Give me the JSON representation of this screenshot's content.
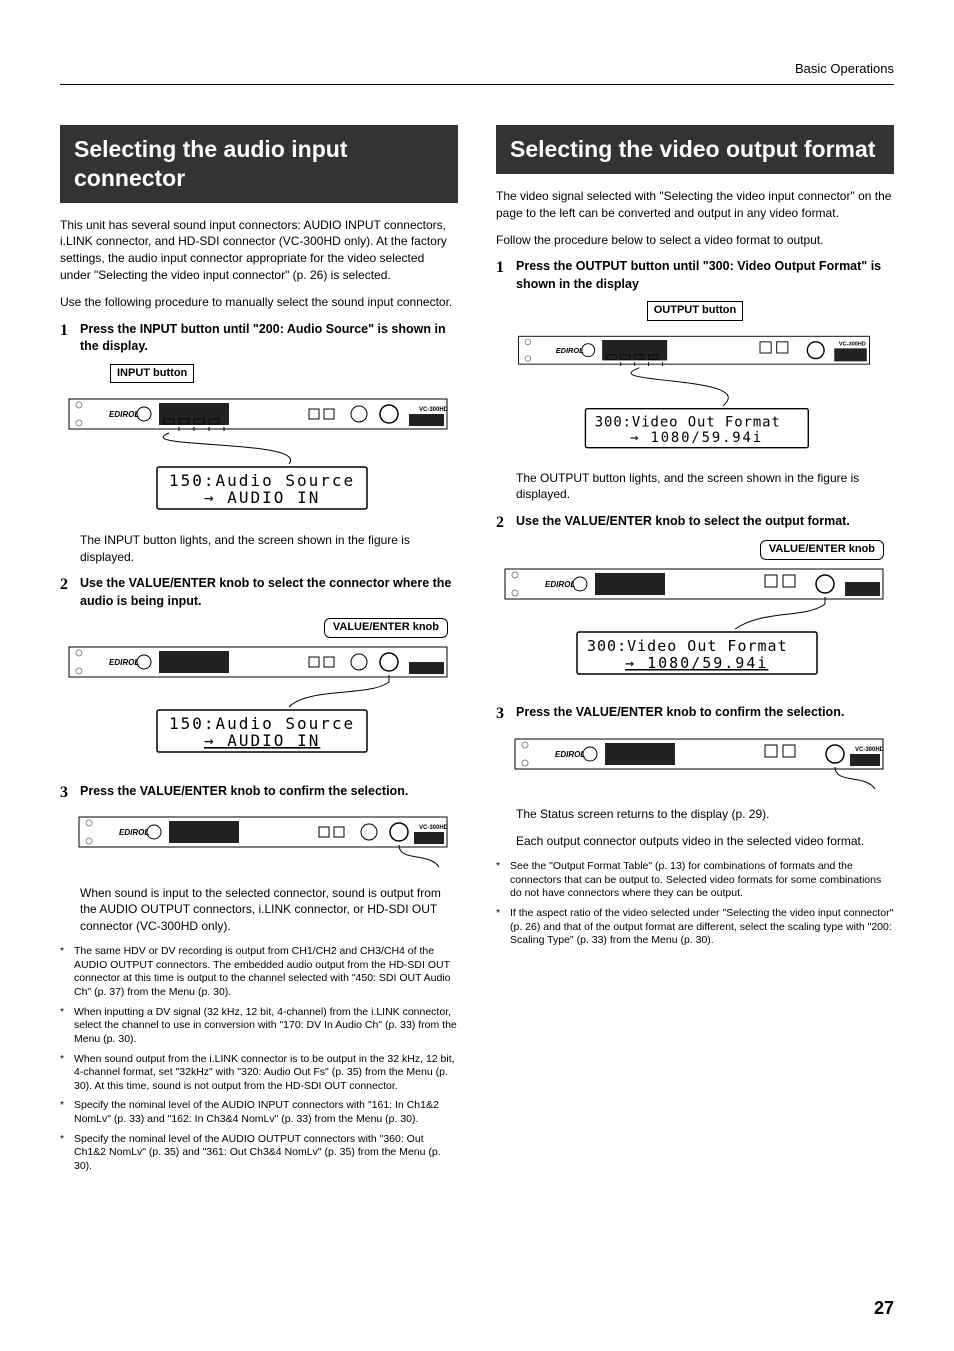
{
  "header": {
    "right": "Basic Operations"
  },
  "page_number": "27",
  "left": {
    "heading": "Selecting the audio input connector",
    "intro1": "This unit has several sound input connectors: AUDIO INPUT connectors, i.LINK connector, and HD-SDI connector (VC-300HD only). At the factory settings, the audio input connector appropriate for the video selected under  \"Selecting the video input connector\" (p. 26) is selected.",
    "intro2": "Use the following procedure to manually select the sound input connector.",
    "step1": "Press the INPUT button until \"200: Audio Source\" is shown in the display.",
    "label_input": "INPUT button",
    "lcd1_line1": "150:Audio Source",
    "lcd1_line2": "AUDIO IN",
    "after1": "The INPUT button lights, and the screen shown in the figure is displayed.",
    "step2": "Use the VALUE/ENTER knob to select the connector where the audio is being input.",
    "label_value": "VALUE/ENTER knob",
    "lcd2_line1": "150:Audio Source",
    "lcd2_line2": "AUDIO IN",
    "step3": "Press the VALUE/ENTER knob to confirm the selection.",
    "after3": "When sound is input to the selected connector, sound is output from the AUDIO OUTPUT connectors, i.LINK connector, or HD-SDI OUT connector (VC-300HD only).",
    "notes": [
      "The same HDV or DV recording is output from CH1/CH2 and CH3/CH4 of the AUDIO OUTPUT connectors. The embedded audio output from the HD-SDI OUT connector at this time is output to the channel selected with \"450: SDI OUT Audio Ch\" (p. 37) from the Menu (p. 30).",
      "When inputting a DV signal (32 kHz, 12 bit, 4-channel) from the i.LINK connector, select the channel to use in conversion with \"170: DV In Audio Ch\" (p. 33) from the Menu (p. 30).",
      "When sound output from the i.LINK connector is to be output in the 32 kHz, 12 bit, 4-channel format, set \"32kHz\" with \"320: Audio Out Fs\" (p. 35) from the Menu (p. 30). At this time, sound is not output from the HD-SDI OUT connector.",
      "Specify the nominal level of the AUDIO INPUT connectors with \"161: In Ch1&2 NomLv\" (p. 33) and \"162: In Ch3&4 NomLv\" (p. 33) from the Menu (p. 30).",
      "Specify the nominal level of the AUDIO OUTPUT connectors with \"360: Out Ch1&2 NomLv\" (p. 35) and \"361: Out Ch3&4 NomLv\" (p. 35) from the Menu (p. 30)."
    ]
  },
  "right": {
    "heading": "Selecting the video output format",
    "intro1": "The video signal selected with \"Selecting the video input connector\" on the page to the left can be converted and output in any video format.",
    "intro2": "Follow the procedure below to select a video format to output.",
    "step1": "Press the OUTPUT button until \"300: Video Output Format\" is shown in the display",
    "label_output": "OUTPUT button",
    "lcd1_line1": "300:Video Out Format",
    "lcd1_line2": "1080/59.94i",
    "after1": "The OUTPUT button lights, and the screen shown in the figure is displayed.",
    "step2": "Use the VALUE/ENTER knob to select the output format.",
    "label_value": "VALUE/ENTER knob",
    "lcd2_line1": "300:Video Out Format",
    "lcd2_line2": "1080/59.94i",
    "step3": "Press the VALUE/ENTER knob to confirm the selection.",
    "after3a": "The Status screen returns to the display (p. 29).",
    "after3b": "Each output connector outputs video in the selected video format.",
    "notes": [
      "See the \"Output Format Table\" (p. 13) for combinations of formats and the connectors that can be output to. Selected video formats for some combinations do not have connectors where they can be output.",
      "If the aspect ratio of the video selected under \"Selecting the video input connector\" (p. 26) and that of the output format are different, select the scaling type with \"200: Scaling Type\" (p. 33) from the Menu (p. 30)."
    ]
  },
  "model": "VC-300HD",
  "brand": "EDIROL"
}
